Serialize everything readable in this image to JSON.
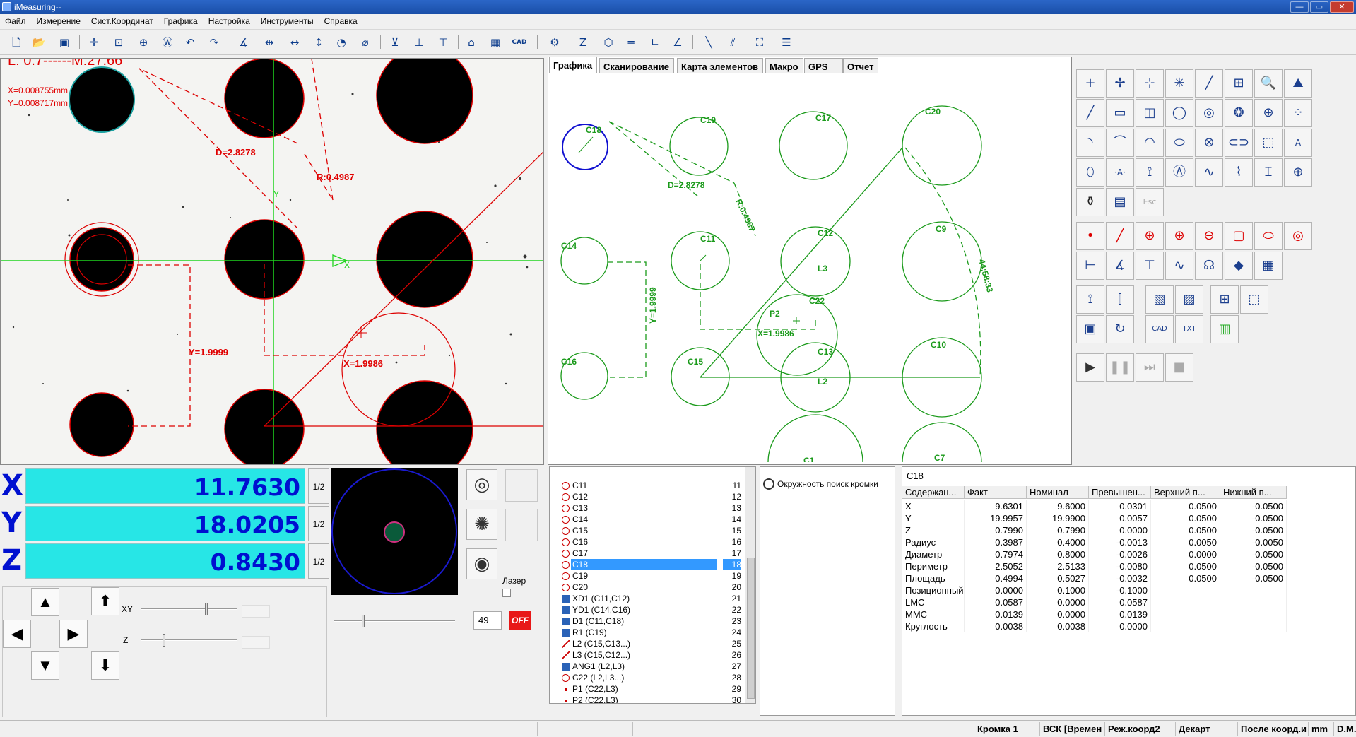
{
  "window": {
    "title": "iMeasuring--",
    "buttons": {
      "min": "—",
      "max": "▭",
      "close": "✕"
    }
  },
  "menu": [
    "Файл",
    "Измерение",
    "Сист.Координат",
    "Графика",
    "Настройка",
    "Инструменты",
    "Справка"
  ],
  "camera": {
    "overlay_L": "L: 0.7------M:27.66",
    "overlay_x": "X=0.008755mm",
    "overlay_y": "Y=0.008717mm",
    "dim_D": "D=2.8278",
    "dim_R": "R:0.4987",
    "dim_Y": "Y=1.9999",
    "dim_X": "X=1.9986",
    "axis_y": "Y",
    "axis_x": "X"
  },
  "graph_tabs": [
    "Графика",
    "Сканирование",
    "Карта элементов",
    "Макро",
    "GPS",
    "Отчет"
  ],
  "graph": {
    "labels": {
      "c18": "C18",
      "c19": "C19",
      "c17": "C17",
      "c20": "C20",
      "c14": "C14",
      "c11": "C11",
      "c12": "C12",
      "c9": "C9",
      "c16": "C16",
      "c15": "C15",
      "c13": "C13",
      "c22": "C22",
      "c10": "C10",
      "c1": "C1",
      "c7": "C7",
      "l3": "L3",
      "l2": "L2",
      "p2": "P2"
    },
    "dim_D": "D=2.8278",
    "dim_R": "R:0.4987",
    "dim_Y": "Y=1.9999",
    "dim_X": "X=1.9986",
    "dim_ang": "44:58:33"
  },
  "dro": {
    "x_axis": "X",
    "y_axis": "Y",
    "z_axis": "Z",
    "x_value": "11.7630",
    "y_value": "18.0205",
    "z_value": "0.8430",
    "half": "1/2"
  },
  "jog": {
    "xy_label": "XY",
    "z_label": "Z",
    "up": "▲",
    "down": "▼",
    "left": "◀",
    "right": "▶",
    "zup": "⬆",
    "zdown": "⬇"
  },
  "lights": {
    "laser_label": "Лазер",
    "intensity": "49",
    "off_label": "OFF"
  },
  "features": [
    {
      "name": "C11",
      "num": "11",
      "type": "circle"
    },
    {
      "name": "C12",
      "num": "12",
      "type": "circle"
    },
    {
      "name": "C13",
      "num": "13",
      "type": "circle"
    },
    {
      "name": "C14",
      "num": "14",
      "type": "circle"
    },
    {
      "name": "C15",
      "num": "15",
      "type": "circle"
    },
    {
      "name": "C16",
      "num": "16",
      "type": "circle"
    },
    {
      "name": "C17",
      "num": "17",
      "type": "circle"
    },
    {
      "name": "C18",
      "num": "18",
      "type": "circle"
    },
    {
      "name": "C19",
      "num": "19",
      "type": "circle"
    },
    {
      "name": "C20",
      "num": "20",
      "type": "circle"
    },
    {
      "name": "XD1 (C11,C12)",
      "num": "21",
      "type": "dim"
    },
    {
      "name": "YD1 (C14,C16)",
      "num": "22",
      "type": "dim"
    },
    {
      "name": "D1 (C11,C18)",
      "num": "23",
      "type": "dim"
    },
    {
      "name": "R1 (C19)",
      "num": "24",
      "type": "dim"
    },
    {
      "name": "L2 (C15,C13...)",
      "num": "25",
      "type": "line"
    },
    {
      "name": "L3 (C15,C12...)",
      "num": "26",
      "type": "line"
    },
    {
      "name": "ANG1 (L2,L3)",
      "num": "27",
      "type": "dim"
    },
    {
      "name": "C22 (L2,L3...)",
      "num": "28",
      "type": "circle"
    },
    {
      "name": "P1 (C22,L3)",
      "num": "29",
      "type": "pt"
    },
    {
      "name": "P2 (C22,L3)",
      "num": "30",
      "type": "pt"
    }
  ],
  "selected_feature": "C18",
  "tool": {
    "label": "Окружность поиск кромки"
  },
  "results": {
    "title": "C18",
    "headers": [
      "Содержан...",
      "Факт",
      "Номинал",
      "Превышен...",
      "Верхний п...",
      "Нижний п..."
    ],
    "rows": [
      [
        "X",
        "9.6301",
        "9.6000",
        "0.0301",
        "0.0500",
        "-0.0500"
      ],
      [
        "Y",
        "19.9957",
        "19.9900",
        "0.0057",
        "0.0500",
        "-0.0500"
      ],
      [
        "Z",
        "0.7990",
        "0.7990",
        "0.0000",
        "0.0500",
        "-0.0500"
      ],
      [
        "Радиус",
        "0.3987",
        "0.4000",
        "-0.0013",
        "0.0050",
        "-0.0050"
      ],
      [
        "Диаметр",
        "0.7974",
        "0.8000",
        "-0.0026",
        "0.0000",
        "-0.0500"
      ],
      [
        "Периметр",
        "2.5052",
        "2.5133",
        "-0.0080",
        "0.0500",
        "-0.0500"
      ],
      [
        "Площадь",
        "0.4994",
        "0.5027",
        "-0.0032",
        "0.0500",
        "-0.0500"
      ],
      [
        "Позиционный",
        "0.0000",
        "0.1000",
        "-0.1000",
        "",
        ""
      ],
      [
        "LMC",
        "0.0587",
        "0.0000",
        "0.0587",
        "",
        ""
      ],
      [
        "MMC",
        "0.0139",
        "0.0000",
        "0.0139",
        "",
        ""
      ],
      [
        "Круглость",
        "0.0038",
        "0.0038",
        "0.0000",
        "",
        ""
      ]
    ]
  },
  "status": [
    "Кромка 1",
    "ВСК [Времен",
    "Реж.коорд2",
    "Декарт",
    "После коорд.и",
    "mm",
    "D.M.S"
  ]
}
